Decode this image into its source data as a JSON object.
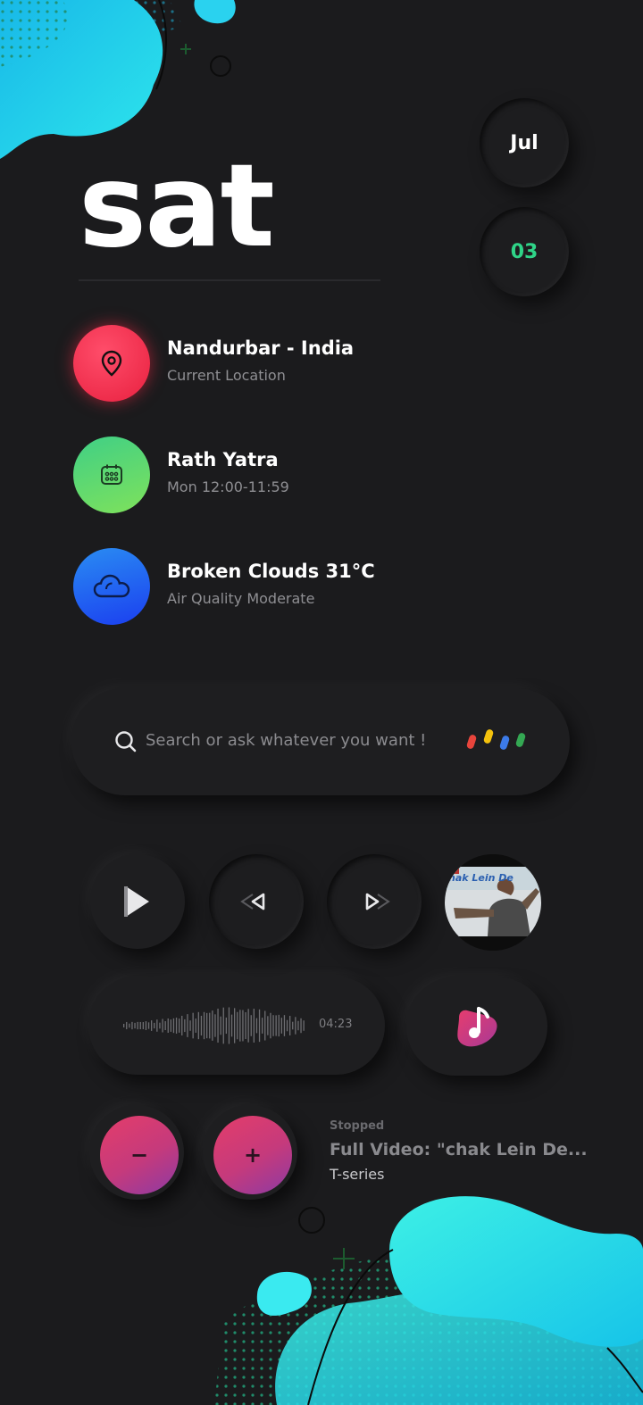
{
  "header": {
    "day": "sat",
    "month": "Jul",
    "date": "03"
  },
  "info_rows": [
    {
      "title": "Nandurbar - India",
      "subtitle": "Current Location",
      "icon": "map-pin-icon"
    },
    {
      "title": "Rath Yatra",
      "subtitle": "Mon 12:00-11:59",
      "icon": "calendar-icon"
    },
    {
      "title": "Broken Clouds 31°C",
      "subtitle": "Air Quality Moderate",
      "icon": "cloud-icon"
    }
  ],
  "search": {
    "placeholder": "Search or ask whatever you want !",
    "assistant_colors": [
      "#e8453c",
      "#f4c20d",
      "#3c7be8",
      "#34a853"
    ]
  },
  "player": {
    "thumbnail_text": "hak Lein De",
    "duration": "04:23",
    "status": "Stopped",
    "track_title": "Full Video: \"chak Lein De...",
    "artist": "T-series",
    "minus_label": "−",
    "plus_label": "+"
  },
  "colors": {
    "accent_green": "#2fd488",
    "location_red": "#f0364f",
    "event_green": "#5fd86a",
    "weather_blue": "#2260f0",
    "blob_cyan": "#29d3ee"
  }
}
